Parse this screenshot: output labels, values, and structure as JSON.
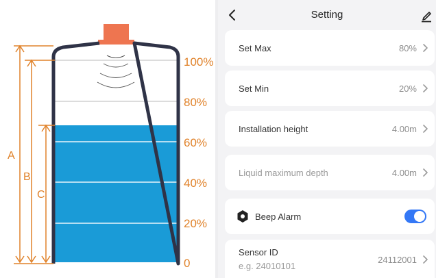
{
  "diagram": {
    "dimension_labels": {
      "a": "A",
      "b": "B",
      "c": "C"
    },
    "percent_labels": [
      "100%",
      "80%",
      "60%",
      "40%",
      "20%",
      "0"
    ],
    "colors": {
      "accent": "#e0822a",
      "liquid": "#1a9bd7",
      "tank_outline": "#2f3347",
      "sensor": "#ee7550"
    },
    "liquid_level_percent": 68
  },
  "header": {
    "title": "Setting",
    "back_icon": "chevron-left-icon",
    "edit_icon": "pencil-icon"
  },
  "settings": {
    "set_max": {
      "label": "Set Max",
      "value": "80%"
    },
    "set_min": {
      "label": "Set Min",
      "value": "20%"
    },
    "installation_height": {
      "label": "Installation height",
      "value": "4.00m"
    },
    "liquid_max_depth": {
      "label": "Liquid maximum depth",
      "value": "4.00m"
    },
    "beep_alarm": {
      "label": "Beep Alarm",
      "enabled": true,
      "icon": "hexagon-alarm-icon"
    },
    "sensor_id": {
      "label": "Sensor ID",
      "placeholder": "e.g. 24010101",
      "value": "24112001"
    }
  },
  "colors": {
    "toggle_on": "#3478f6",
    "panel_bg": "#f3f3f5"
  }
}
